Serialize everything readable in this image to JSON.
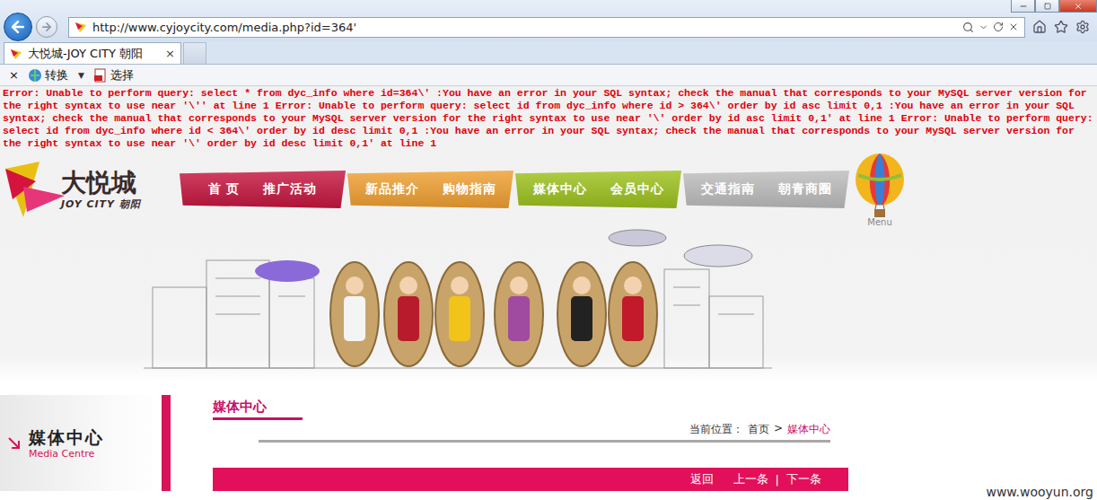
{
  "browser": {
    "url": "http://www.cyjoycity.com/media.php?id=364'",
    "tabs": [
      {
        "label": "大悦城-JOY CITY 朝阳",
        "selected": true,
        "close": "×"
      },
      {
        "label": "",
        "selected": false,
        "close": ""
      }
    ],
    "command_bar": {
      "close": "×",
      "menu_glyph": "▼",
      "items": [
        {
          "label": "转换",
          "has_menu": true
        },
        {
          "label": "选择",
          "has_menu": false
        }
      ]
    }
  },
  "error": "Error: Unable to perform query: select * from dyc_info where id=364\\' :You have an error in your SQL syntax; check the manual that corresponds to your MySQL server version for the right syntax to use near '\\'' at line 1 Error: Unable to perform query: select id from dyc_info where id > 364\\' order by id asc limit 0,1 :You have an error in your SQL syntax; check the manual that corresponds to your MySQL server version for the right syntax to use near '\\' order by id asc limit 0,1' at line 1 Error: Unable to perform query: select id from dyc_info where id < 364\\' order by id desc limit 0,1 :You have an error in your SQL syntax; check the manual that corresponds to your MySQL server version for the right syntax to use near '\\' order by id desc limit 0,1' at line 1",
  "site": {
    "logo": {
      "name": "大悦城",
      "sub": "JOY CITY",
      "city": "朝阳"
    },
    "nav_groups": [
      {
        "color": "#c5163f",
        "items": [
          "首 页",
          "推广活动"
        ]
      },
      {
        "color": "#f0a032",
        "items": [
          "新品推介",
          "购物指南"
        ]
      },
      {
        "color": "#9dc21e",
        "items": [
          "媒体中心",
          "会员中心"
        ]
      },
      {
        "color": "#bdbdbd",
        "items": [
          "交通指南",
          "朝青商圈"
        ]
      }
    ],
    "balloon": "Menu"
  },
  "sidebar": {
    "title": "媒体中心",
    "subtitle": "Media Centre"
  },
  "content": {
    "title": "媒体中心",
    "breadcrumb": {
      "label": "当前位置：",
      "separator": ">",
      "items": [
        {
          "label": "首页",
          "current": false
        },
        {
          "label": "媒体中心",
          "current": true
        }
      ]
    },
    "bar": {
      "back": "返回",
      "prev": "上一条",
      "separator": "|",
      "next": "下一条"
    }
  },
  "watermark": "www.wooyun.org"
}
